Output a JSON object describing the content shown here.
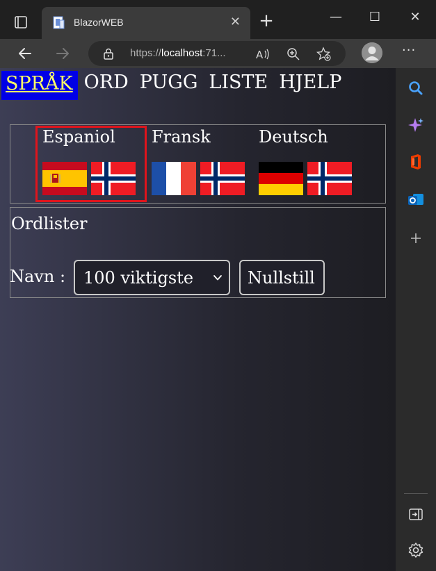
{
  "browser": {
    "tab_title": "BlazorWEB",
    "close_tab_glyph": "✕",
    "new_tab_glyph": "+",
    "url_scheme": "https://",
    "url_host": "localhost",
    "url_rest": ":71...",
    "window_controls": {
      "minimize": "—",
      "maximize": "☐",
      "close": "✕"
    },
    "more_glyph": "···",
    "icons": [
      "tab-actions-icon",
      "back-arrow-icon",
      "forward-arrow-icon",
      "lock-icon",
      "read-aloud-icon",
      "zoom-icon",
      "favorites-icon",
      "profile-icon",
      "more-icon"
    ]
  },
  "sidebar": {
    "icons": [
      "search-icon",
      "copilot-icon",
      "office-icon",
      "outlook-icon",
      "add-icon",
      "hide-sidebar-icon",
      "settings-icon"
    ]
  },
  "menu": {
    "items": [
      {
        "label": "SPRÅK",
        "active": true
      },
      {
        "label": "ORD",
        "active": false
      },
      {
        "label": "PUGG",
        "active": false
      },
      {
        "label": "LISTE",
        "active": false
      },
      {
        "label": "HJELP",
        "active": false
      }
    ]
  },
  "languages": [
    {
      "name": "Espaniol",
      "flags": [
        "spain-flag",
        "norway-flag"
      ],
      "selected": true
    },
    {
      "name": "Fransk",
      "flags": [
        "france-flag",
        "norway-flag"
      ],
      "selected": false
    },
    {
      "name": "Deutsch",
      "flags": [
        "germany-flag",
        "norway-flag"
      ],
      "selected": false
    }
  ],
  "wordlists": {
    "title": "Ordlister",
    "name_label": "Navn :",
    "selected_list": "100 viktigste",
    "reset_label": "Nullstill"
  },
  "colors": {
    "active_menu_bg": "#0000e6",
    "active_menu_text": "#ffff66",
    "selection_frame": "#e0141c"
  }
}
